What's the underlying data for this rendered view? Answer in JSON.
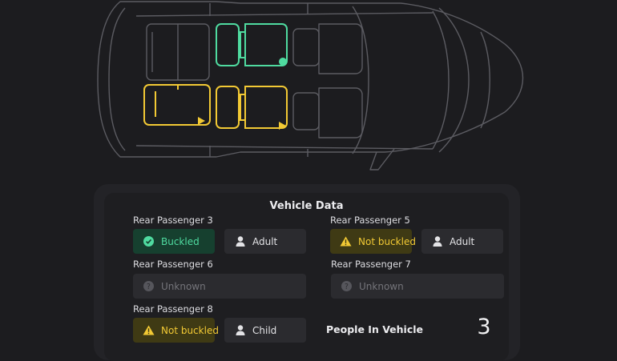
{
  "panel": {
    "title": "Vehicle Data",
    "passengers": [
      {
        "label": "Rear Passenger 3",
        "status": "Buckled",
        "status_type": "buckled",
        "occupant": "Adult"
      },
      {
        "label": "Rear Passenger 5",
        "status": "Not buckled",
        "status_type": "warning",
        "occupant": "Adult"
      },
      {
        "label": "Rear Passenger 6",
        "status": "Unknown",
        "status_type": "unknown"
      },
      {
        "label": "Rear Passenger 7",
        "status": "Unknown",
        "status_type": "unknown"
      },
      {
        "label": "Rear Passenger 8",
        "status": "Not buckled",
        "status_type": "warning",
        "occupant": "Child"
      }
    ],
    "people_label": "People In Vehicle",
    "people_count": "3"
  },
  "colors": {
    "buckled": "#4fdba0",
    "warning": "#f2c934",
    "background": "#1c1c1f",
    "car_outline": "#5c5c62"
  },
  "icons": {
    "buckled": "check-circle-icon",
    "warning": "warning-triangle-icon",
    "occupant": "person-icon",
    "unknown": "question-circle-icon"
  }
}
